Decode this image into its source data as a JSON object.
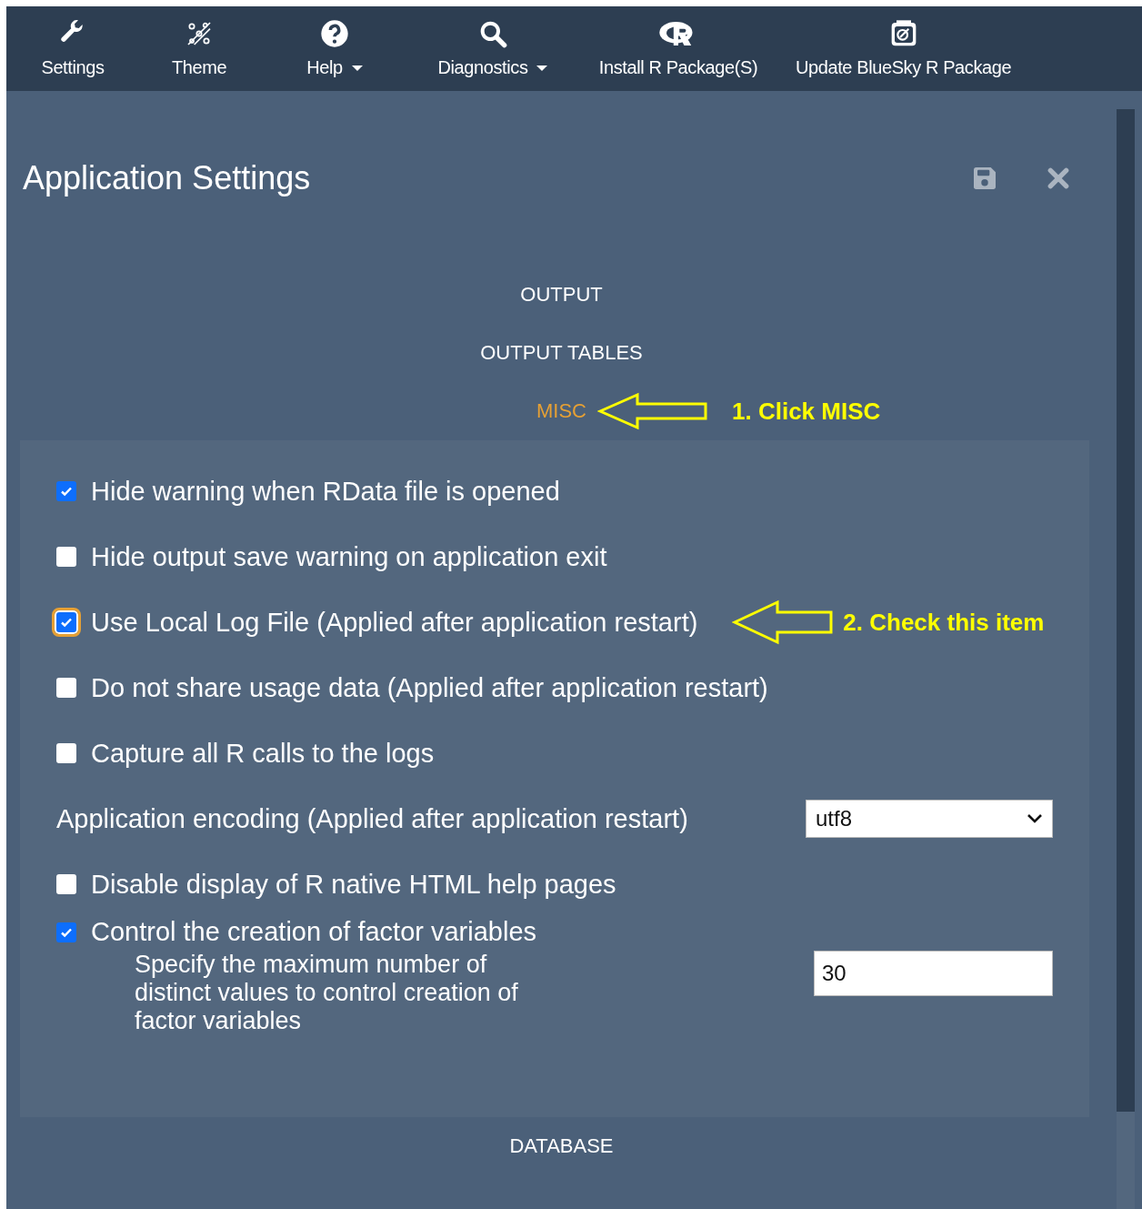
{
  "toolbar": [
    {
      "label": "Settings",
      "dropdown": false
    },
    {
      "label": "Theme",
      "dropdown": false
    },
    {
      "label": "Help",
      "dropdown": true
    },
    {
      "label": "Diagnostics",
      "dropdown": true
    },
    {
      "label": "Install R Package(S)",
      "dropdown": false
    },
    {
      "label": "Update BlueSky R Package",
      "dropdown": false
    }
  ],
  "dialog": {
    "title": "Application Settings",
    "sections": [
      {
        "label": "OUTPUT",
        "selected": false
      },
      {
        "label": "OUTPUT TABLES",
        "selected": false
      },
      {
        "label": "MISC",
        "selected": true,
        "annotation": "1. Click MISC",
        "settings": [
          {
            "kind": "checkbox",
            "label": "Hide warning when RData file is opened",
            "checked": true,
            "focused": false
          },
          {
            "kind": "checkbox",
            "label": "Hide output save warning on application exit",
            "checked": false,
            "focused": false
          },
          {
            "kind": "checkbox",
            "label": "Use Local Log File (Applied after application restart)",
            "checked": true,
            "focused": true,
            "annotation": "2. Check this item"
          },
          {
            "kind": "checkbox",
            "label": "Do not share usage data (Applied after application restart)",
            "checked": false,
            "focused": false
          },
          {
            "kind": "checkbox",
            "label": "Capture all R calls to the logs",
            "checked": false,
            "focused": false
          },
          {
            "kind": "select",
            "label": "Application encoding (Applied after application restart)",
            "value": "utf8"
          },
          {
            "kind": "checkbox",
            "label": "Disable display of R native HTML help pages",
            "checked": false,
            "focused": false
          },
          {
            "kind": "checkbox",
            "label": "Control the creation of factor variables",
            "checked": true,
            "focused": false,
            "sub_label": "Specify the maximum number of distinct values to control creation of factor variables",
            "sub_value": "30"
          }
        ]
      },
      {
        "label": "DATABASE",
        "selected": false
      }
    ]
  }
}
